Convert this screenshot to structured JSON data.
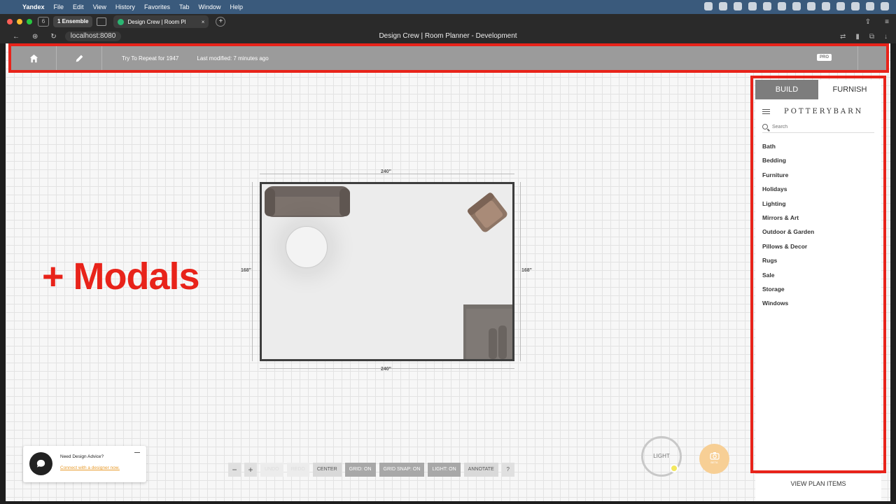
{
  "menubar": {
    "app": "Yandex",
    "items": [
      "File",
      "Edit",
      "View",
      "History",
      "Favorites",
      "Tab",
      "Window",
      "Help"
    ]
  },
  "browser": {
    "tab_group_label": "1  Ensemble",
    "active_tab_title": "Design Crew | Room Pl",
    "url": "localhost:8080",
    "page_title": "Design Crew | Room Planner - Development"
  },
  "toolbar": {
    "doc_title": "Try To Repeat for 1947",
    "modified": "Last modified: 7 minutes ago",
    "pro_badge": "PRO"
  },
  "canvas": {
    "dim_top": "240\"",
    "dim_bottom": "240\"",
    "dim_left": "168\"",
    "dim_right": "168\"",
    "annotation": "+ Modals"
  },
  "panel": {
    "tab_build": "BUILD",
    "tab_furnish": "FURNISH",
    "brand": "POTTERYBARN",
    "search_placeholder": "Search",
    "categories": [
      "Bath",
      "Bedding",
      "Furniture",
      "Holidays",
      "Lighting",
      "Mirrors & Art",
      "Outdoor & Garden",
      "Pillows & Decor",
      "Rugs",
      "Sale",
      "Storage",
      "Windows"
    ],
    "view_plan": "VIEW PLAN ITEMS"
  },
  "controls": {
    "zoom_out": "−",
    "zoom_in": "+",
    "undo": "UNDO",
    "redo": "REDO",
    "center": "CENTER",
    "grid": "GRID: ON",
    "grid_snap": "GRID SNAP: ON",
    "light": "LIGHT: ON",
    "annotate": "ANNOTATE",
    "help": "?",
    "light_dial": "LIGHT",
    "camera_caption": "BETA"
  },
  "advice": {
    "question": "Need Design Advice?",
    "link": "Connect with a designer now."
  },
  "colors": {
    "highlight": "#e8231a",
    "toolbar": "#9b9b9b",
    "link": "#e89a2a"
  }
}
